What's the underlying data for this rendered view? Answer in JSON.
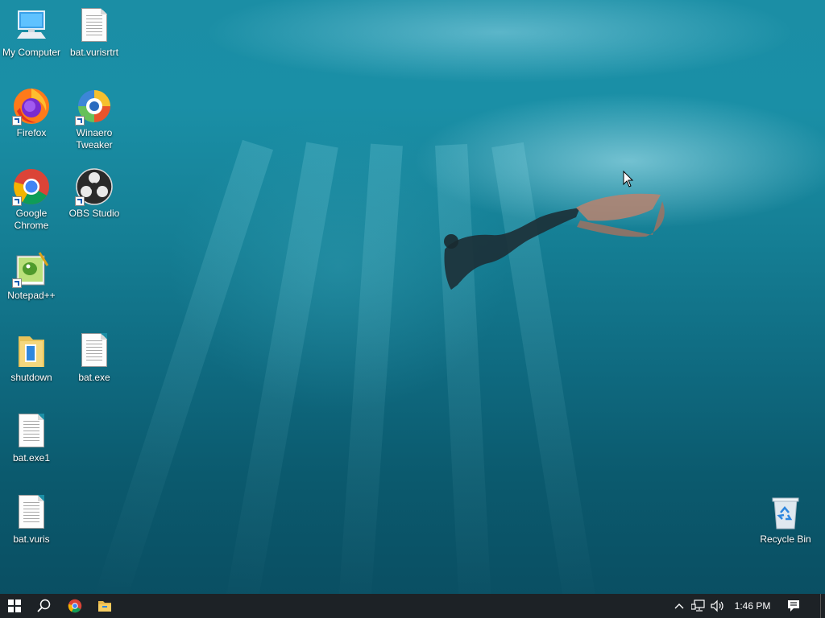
{
  "desktop": {
    "icons": [
      {
        "label": "My Computer",
        "icon": "computer-icon"
      },
      {
        "label": "bat.vurisrtrt",
        "icon": "text-file-icon"
      },
      {
        "label": "Firefox",
        "icon": "firefox-icon"
      },
      {
        "label": "Winaero Tweaker",
        "icon": "winaero-tweaker-icon"
      },
      {
        "label": "Google Chrome",
        "icon": "chrome-icon"
      },
      {
        "label": "OBS Studio",
        "icon": "obs-studio-icon"
      },
      {
        "label": "Notepad++",
        "icon": "notepad-plus-plus-icon"
      },
      {
        "label": "shutdown",
        "icon": "folder-icon"
      },
      {
        "label": "bat.exe",
        "icon": "text-file-icon"
      },
      {
        "label": "bat.exe1",
        "icon": "text-file-icon"
      },
      {
        "label": "bat.vuris",
        "icon": "text-file-icon"
      },
      {
        "label": "Recycle Bin",
        "icon": "recycle-bin-icon"
      }
    ]
  },
  "taskbar": {
    "start": "windows-start-icon",
    "search": "search-icon",
    "pinned": [
      "chrome-icon",
      "file-explorer-icon"
    ],
    "tray": {
      "show_hidden": "chevron-up-icon",
      "network": "network-icon",
      "volume": "volume-icon",
      "clock": "1:46 PM",
      "notifications": "action-center-icon"
    },
    "color": "#1d2226"
  }
}
